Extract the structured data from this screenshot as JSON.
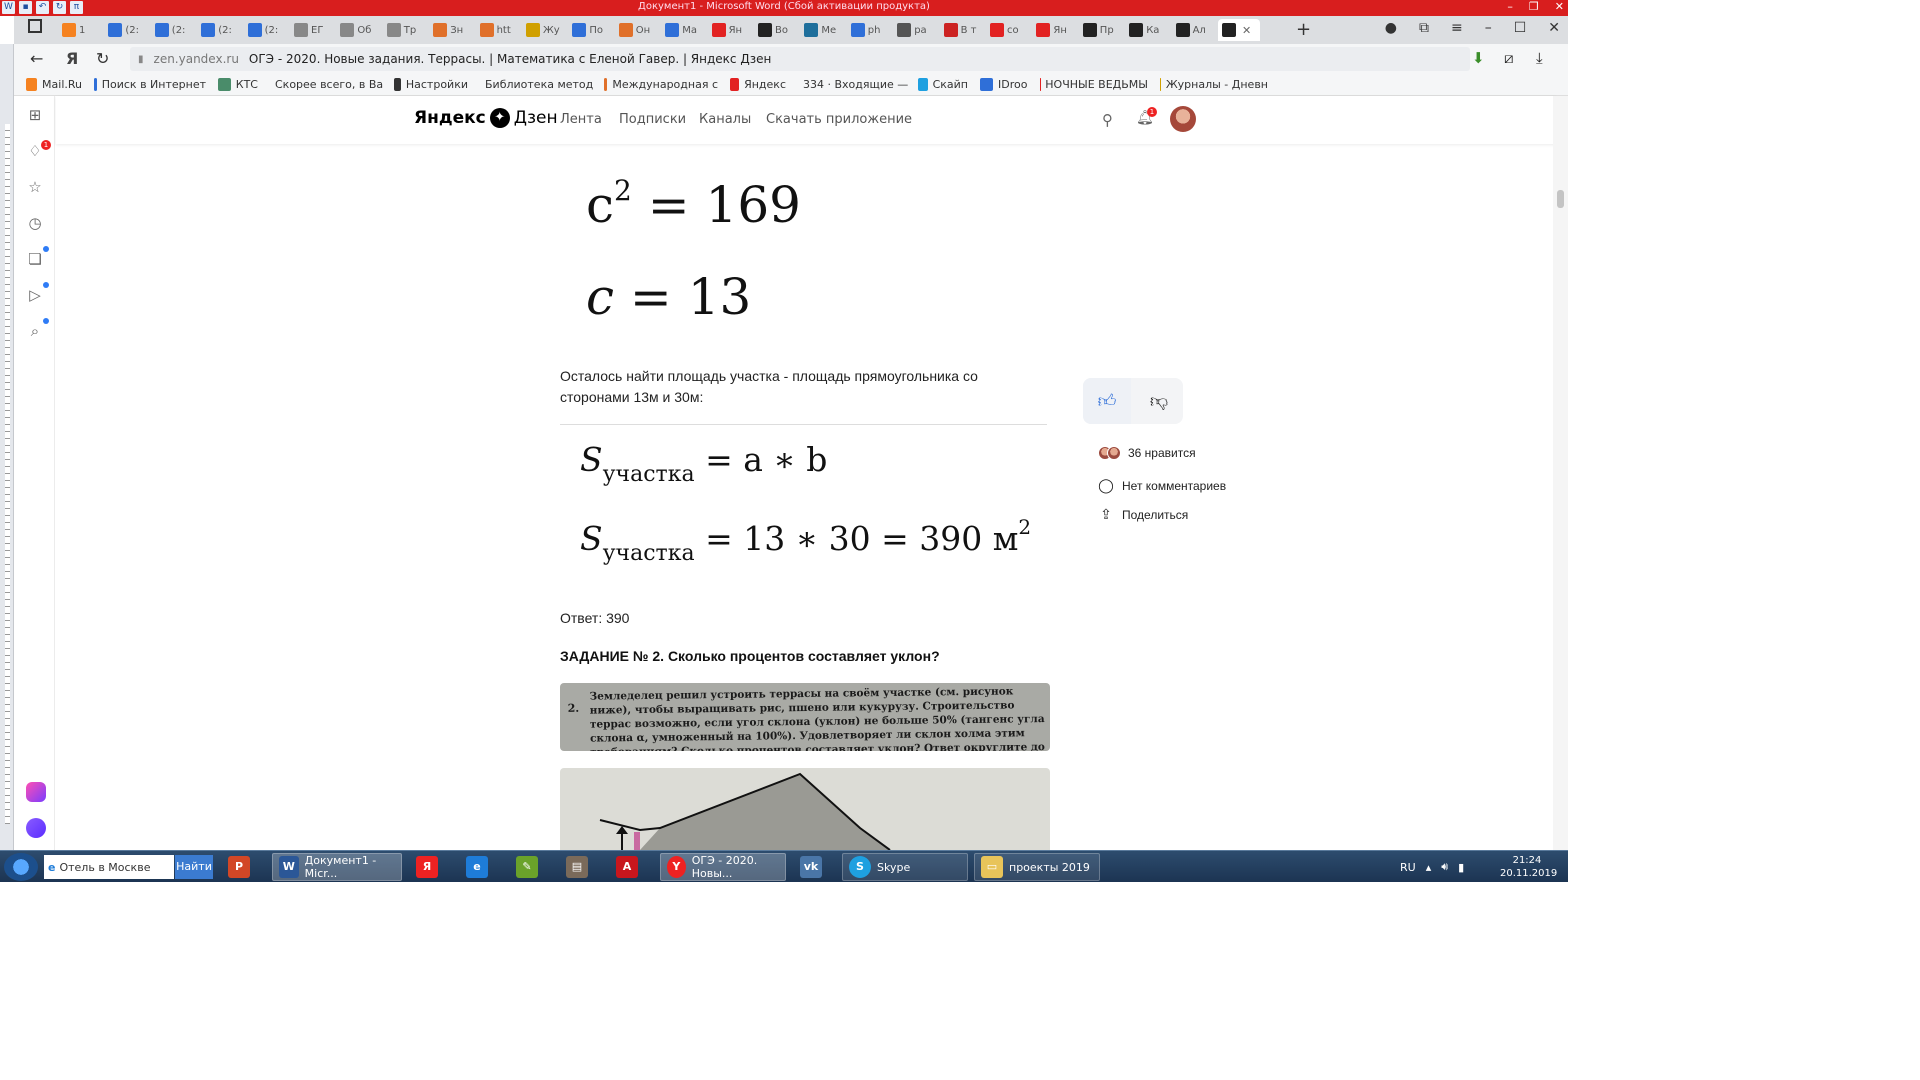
{
  "word": {
    "title": "Документ1 - Microsoft Word (Сбой активации продукта)"
  },
  "tabs": [
    {
      "label": "1 ",
      "icon": "mail-icon",
      "color": "#f58220"
    },
    {
      "label": "(2:",
      "icon": "mail-icon",
      "color": "#2f6fd8"
    },
    {
      "label": "(2:",
      "icon": "mail-icon",
      "color": "#2f6fd8"
    },
    {
      "label": "(2:",
      "icon": "mail-icon",
      "color": "#2f6fd8"
    },
    {
      "label": "(2:",
      "icon": "mail-icon",
      "color": "#2f6fd8"
    },
    {
      "label": "ЕГ",
      "icon": "edit-icon",
      "color": "#888888"
    },
    {
      "label": "Об",
      "icon": "edit-icon",
      "color": "#888888"
    },
    {
      "label": "Тр",
      "icon": "edit-icon",
      "color": "#888888"
    },
    {
      "label": "Зн",
      "icon": "fox-icon",
      "color": "#e0702a"
    },
    {
      "label": "htt",
      "icon": "fox-icon",
      "color": "#e0702a"
    },
    {
      "label": "Жу",
      "icon": "puzzle-icon",
      "color": "#d0a000"
    },
    {
      "label": "По",
      "icon": "mail-icon",
      "color": "#2f6fd8"
    },
    {
      "label": "Он",
      "icon": "fox-icon",
      "color": "#e0702a"
    },
    {
      "label": "Ма",
      "icon": "chat-icon",
      "color": "#2f6fd8"
    },
    {
      "label": "Ян",
      "icon": "yandex-icon",
      "color": "#e22222"
    },
    {
      "label": "Во",
      "icon": "zen-icon",
      "color": "#222222"
    },
    {
      "label": "Ме",
      "icon": "box-icon",
      "color": "#1e6f9c"
    },
    {
      "label": "ph",
      "icon": "doc-icon",
      "color": "#2f6fd8"
    },
    {
      "label": "ра",
      "icon": "doc-icon",
      "color": "#555555"
    },
    {
      "label": "В т",
      "icon": "news-icon",
      "color": "#cc2222"
    },
    {
      "label": "со",
      "icon": "yandex-icon",
      "color": "#e22222"
    },
    {
      "label": "Ян",
      "icon": "yandex-icon",
      "color": "#e22222"
    },
    {
      "label": "Пр",
      "icon": "zen-icon",
      "color": "#222222"
    },
    {
      "label": "Ка",
      "icon": "zen-icon",
      "color": "#222222"
    },
    {
      "label": "Ал",
      "icon": "zen-icon",
      "color": "#222222"
    },
    {
      "label": "",
      "icon": "zen-icon",
      "color": "#222222",
      "active": true
    }
  ],
  "address": {
    "domain": "zen.yandex.ru",
    "title": "ОГЭ - 2020. Новые задания. Террасы. | Математика с Еленой Гавер. | Яндекс Дзен"
  },
  "bookmarks": [
    {
      "label": "Mail.Ru",
      "icon": "at-icon",
      "color": "#f58220"
    },
    {
      "label": "Поиск в Интернет",
      "icon": "search-icon",
      "color": "#2f6fd8"
    },
    {
      "label": "КТС",
      "icon": "image-icon",
      "color": "#4a8c6a"
    },
    {
      "label": "Скорее всего, в Ва",
      "icon": "image-icon",
      "color": "#4a8c6a"
    },
    {
      "label": "Настройки",
      "icon": "gear-icon",
      "color": "#333333"
    },
    {
      "label": "Библиотека метод",
      "icon": "diamond-icon",
      "color": "#6a3cb0"
    },
    {
      "label": "Международная с",
      "icon": "fox-icon",
      "color": "#e0702a"
    },
    {
      "label": "Яндекс",
      "icon": "yandex-icon",
      "color": "#e22222"
    },
    {
      "label": "334 · Входящие —",
      "icon": "envelope-icon",
      "color": "#f0a000"
    },
    {
      "label": "Скайп",
      "icon": "skype-icon",
      "color": "#1ea0e0"
    },
    {
      "label": "IDroo",
      "icon": "board-icon",
      "color": "#2f6fd8"
    },
    {
      "label": "НОЧНЫЕ ВЕДЬМЫ",
      "icon": "youtube-icon",
      "color": "#e22222"
    },
    {
      "label": "Журналы - Дневн",
      "icon": "hand-icon",
      "color": "#d0a000"
    }
  ],
  "panel": {
    "notifications_badge": "1"
  },
  "zen": {
    "logo_left": "Яндекс",
    "logo_right": "Дзен",
    "nav": [
      "Лента",
      "Подписки",
      "Каналы",
      "Скачать приложение"
    ],
    "bell_badge": "1"
  },
  "article": {
    "f1_base": "c",
    "f1_exp": "2",
    "f1_rhs": "= 169",
    "f2_var": "c",
    "f2_rhs": "= 13",
    "paragraph": "Осталось найти площадь участка - площадь прямоугольника со сторонами 13м и 30м:",
    "f3_S": "S",
    "f3_sub": "участка",
    "f3_rhs": "= a ∗ b",
    "f4_S": "S",
    "f4_sub": "участка",
    "f4_rhs": "= 13 ∗ 30 = 390 м",
    "f4_exp": "2",
    "answer": "Ответ: 390",
    "task_title": "ЗАДАНИЕ № 2. Сколько процентов составляет уклон?",
    "task_num": "2.",
    "task_text": "Земледелец решил устроить террасы на своём участке (см. рисунок ниже), чтобы выращивать рис, пшено или кукурузу. Строительство террас возможно, если угол склона (уклон) не больше 50% (тангенс угла склона α, умноженный на 100%). Удовлетворяет ли склон холма этим требованиям? Сколько процентов составляет уклон? Ответ округлите до десятых."
  },
  "reactions": {
    "likes": "36 нравится",
    "comments": "Нет комментариев",
    "share": "Поделиться"
  },
  "taskbar": {
    "search_text": "Отель в Москве",
    "search_button": "Найти",
    "word_item": "Документ1 - Micr...",
    "browser_item": "ОГЭ - 2020. Новы...",
    "skype_item": "Skype",
    "folder_item": "проекты 2019",
    "lang": "RU",
    "time": "21:24",
    "date": "20.11.2019"
  }
}
